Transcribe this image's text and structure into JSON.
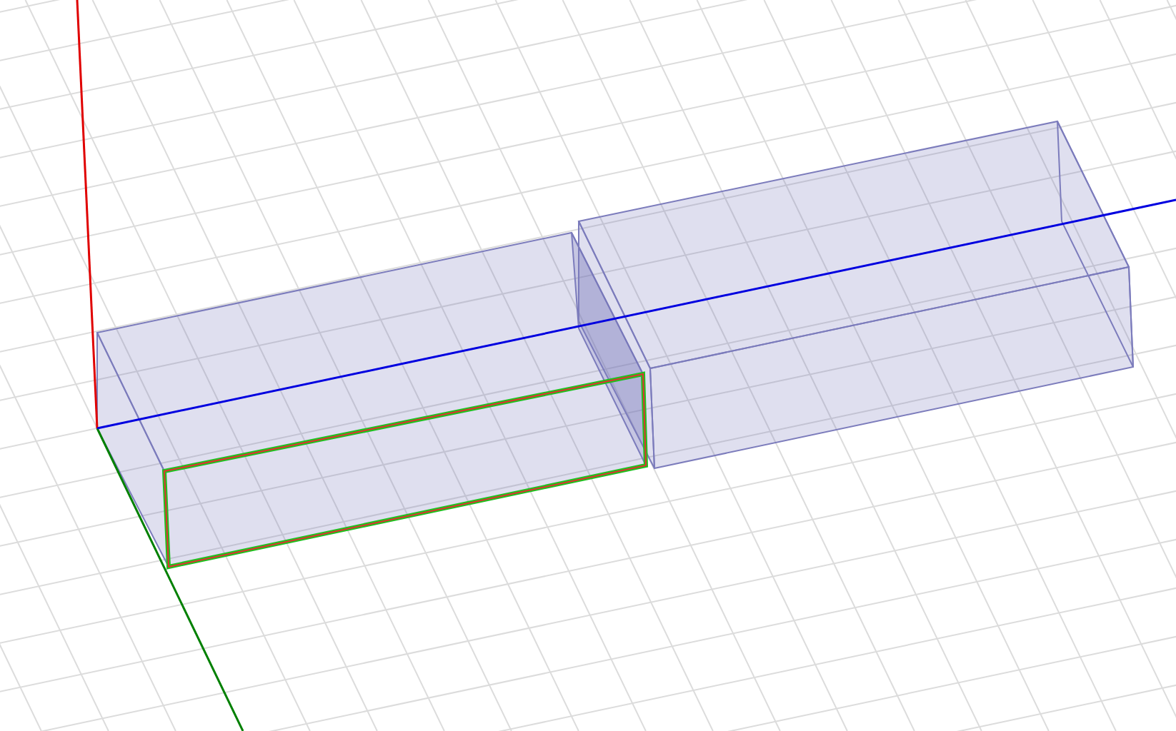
{
  "viewport": {
    "face_highlighted": true
  }
}
